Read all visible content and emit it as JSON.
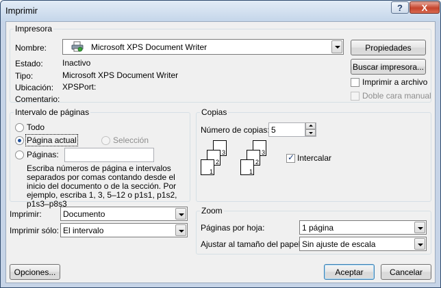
{
  "window": {
    "title": "Imprimir",
    "help_label": "?",
    "close_label": "X"
  },
  "printer": {
    "group_title": "Impresora",
    "name_label": "Nombre:",
    "name_value": "Microsoft XPS Document Writer",
    "status_label": "Estado:",
    "status_value": "Inactivo",
    "type_label": "Tipo:",
    "type_value": "Microsoft XPS Document Writer",
    "location_label": "Ubicación:",
    "location_value": "XPSPort:",
    "comment_label": "Comentario:",
    "comment_value": "",
    "properties_button": "Propiedades",
    "find_printer_button": "Buscar impresora...",
    "print_to_file_label": "Imprimir a archivo",
    "print_to_file_checked": false,
    "duplex_label": "Doble cara manual",
    "duplex_checked": false
  },
  "page_range": {
    "group_title": "Intervalo de páginas",
    "all_label": "Todo",
    "current_label": "Página actual",
    "selection_label": "Selección",
    "pages_label": "Páginas:",
    "pages_value": "",
    "selected": "current",
    "help_text": "Escriba números de página e intervalos separados por comas contando desde el inicio del documento o de la sección. Por ejemplo, escriba 1, 3, 5–12 o p1s1, p1s2, p1s3–p8s3"
  },
  "copies": {
    "group_title": "Copias",
    "count_label": "Número de copias:",
    "count_value": "5",
    "collate_label": "Intercalar",
    "collate_checked": true,
    "stack_pages": [
      "1",
      "2",
      "3"
    ]
  },
  "print_what": {
    "print_label": "Imprimir:",
    "print_value": "Documento",
    "print_only_label": "Imprimir sólo:",
    "print_only_value": "El intervalo"
  },
  "zoom": {
    "group_title": "Zoom",
    "pages_per_sheet_label": "Páginas por hoja:",
    "pages_per_sheet_value": "1 página",
    "scale_label": "Ajustar al tamaño del papel:",
    "scale_value": "Sin ajuste de escala"
  },
  "buttons": {
    "options": "Opciones...",
    "ok": "Aceptar",
    "cancel": "Cancelar"
  }
}
